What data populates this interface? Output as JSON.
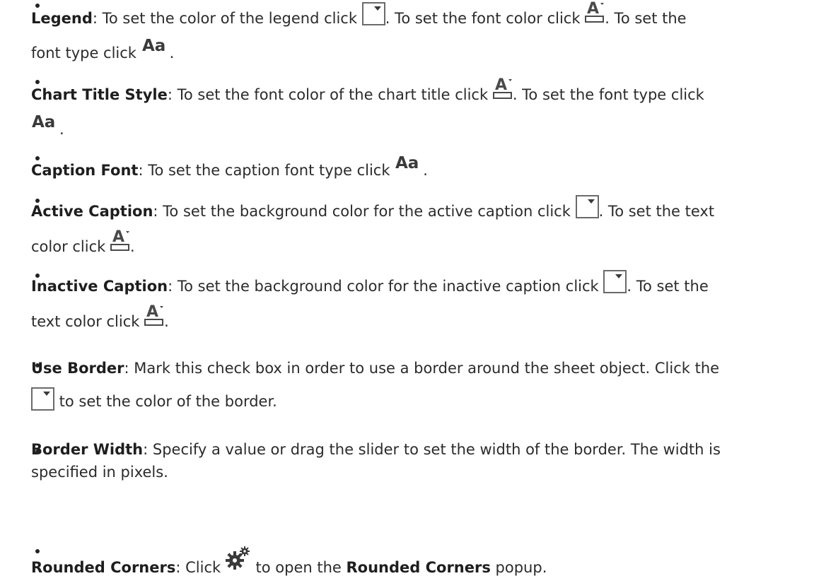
{
  "items": [
    {
      "title": "Legend",
      "t1": ": To set the color of the legend click ",
      "t2": ". To set the font color click ",
      "t3": ". To set the",
      "t4": "font type click ",
      "t5": "."
    },
    {
      "title": "Chart Title Style",
      "t1": ": To set the font color of the chart title click ",
      "t2": ". To set the font type click",
      "t3": "."
    },
    {
      "title": "Caption Font",
      "t1": ": To set the caption font type click ",
      "t2": "."
    },
    {
      "title": "Active Caption",
      "t1": ": To set the background color for the active caption click ",
      "t2": ". To set the text",
      "t3": "color click ",
      "t4": "."
    },
    {
      "title": "Inactive Caption",
      "t1": ": To set the background color for the inactive caption click ",
      "t2": ". To set the",
      "t3": "text color click ",
      "t4": "."
    },
    {
      "title": "Use Border",
      "t1": ": Mark this check box in order to use a border around the sheet object. Click the",
      "t2": " to set the color of the border."
    },
    {
      "title": "Border Width",
      "t1": ": Specify a value or drag the slider to set the width of the border. The width is",
      "t2": "specified in pixels."
    },
    {
      "title": "Rounded Corners",
      "t1": ": Click ",
      "t2": " to open the ",
      "bold2": "Rounded Corners",
      "t3": " popup."
    }
  ],
  "icons": {
    "color_picker": "color-picker-icon",
    "font_color": "font-color-icon",
    "font_type": "font-type-icon",
    "gear": "gear-icon",
    "font_type_glyph": "Aa",
    "font_color_glyph": "A"
  }
}
